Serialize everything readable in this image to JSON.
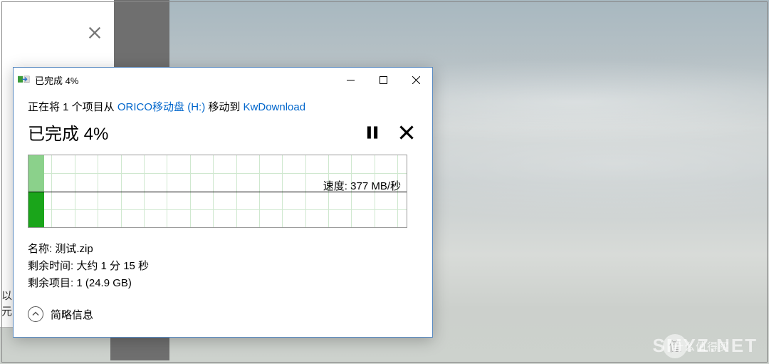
{
  "titlebar": {
    "title": "已完成 4%"
  },
  "back_window": {
    "partial_text_1": "以",
    "partial_text_2": "元"
  },
  "transfer": {
    "prefix": "正在将 1 个项目从 ",
    "source": "ORICO移动盘 (H:)",
    "mid": " 移动到 ",
    "dest": "KwDownload",
    "heading": "已完成 4%",
    "speed_label": "速度: 377 MB/秒",
    "name_label": "名称: ",
    "name_value": "测试.zip",
    "time_label": "剩余时间: ",
    "time_value": "大约 1 分 15 秒",
    "items_label": "剩余项目: ",
    "items_value": "1 (24.9 GB)",
    "footer": "简略信息"
  },
  "chart_data": {
    "type": "area",
    "title": "",
    "xlabel": "",
    "ylabel": "",
    "x": [
      0,
      4,
      100
    ],
    "series": [
      {
        "name": "transfer-speed",
        "values": [
          377,
          377,
          null
        ]
      }
    ],
    "ylim": [
      0,
      754
    ],
    "progress_percent": 4,
    "speed_text": "速度: 377 MB/秒",
    "midline_value": 377
  },
  "watermarks": {
    "site": "SMYZ.NET",
    "brand_char": "值",
    "brand_text": "什么值得买"
  }
}
